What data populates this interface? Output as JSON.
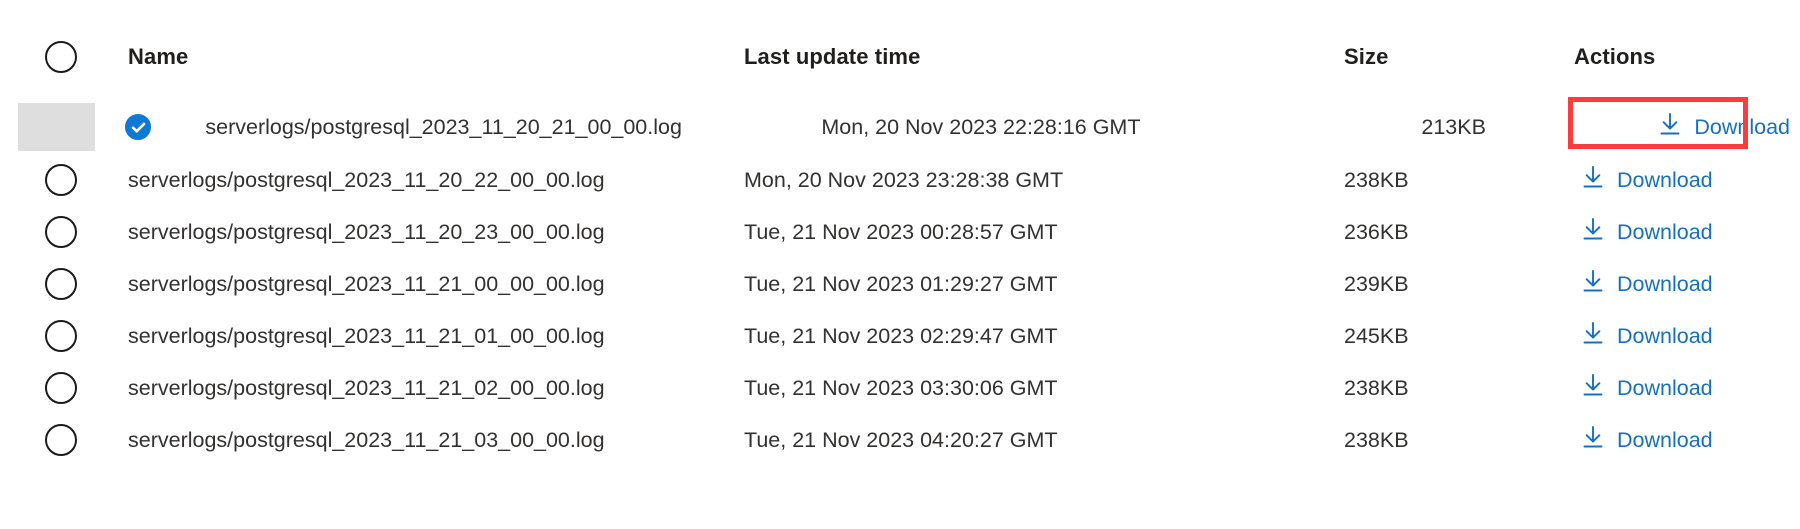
{
  "table": {
    "columns": {
      "select": "",
      "name": "Name",
      "last_update_time": "Last update time",
      "size": "Size",
      "actions": "Actions"
    },
    "select_all_state": "unchecked",
    "rows": [
      {
        "selected": true,
        "name": "serverlogs/postgresql_2023_11_20_21_00_00.log",
        "last_update_time": "Mon, 20 Nov 2023 22:28:16 GMT",
        "size": "213KB",
        "action_label": "Download"
      },
      {
        "selected": false,
        "name": "serverlogs/postgresql_2023_11_20_22_00_00.log",
        "last_update_time": "Mon, 20 Nov 2023 23:28:38 GMT",
        "size": "238KB",
        "action_label": "Download"
      },
      {
        "selected": false,
        "name": "serverlogs/postgresql_2023_11_20_23_00_00.log",
        "last_update_time": "Tue, 21 Nov 2023 00:28:57 GMT",
        "size": "236KB",
        "action_label": "Download"
      },
      {
        "selected": false,
        "name": "serverlogs/postgresql_2023_11_21_00_00_00.log",
        "last_update_time": "Tue, 21 Nov 2023 01:29:27 GMT",
        "size": "239KB",
        "action_label": "Download"
      },
      {
        "selected": false,
        "name": "serverlogs/postgresql_2023_11_21_01_00_00.log",
        "last_update_time": "Tue, 21 Nov 2023 02:29:47 GMT",
        "size": "245KB",
        "action_label": "Download"
      },
      {
        "selected": false,
        "name": "serverlogs/postgresql_2023_11_21_02_00_00.log",
        "last_update_time": "Tue, 21 Nov 2023 03:30:06 GMT",
        "size": "238KB",
        "action_label": "Download"
      },
      {
        "selected": false,
        "name": "serverlogs/postgresql_2023_11_21_03_00_00.log",
        "last_update_time": "Tue, 21 Nov 2023 04:20:27 GMT",
        "size": "238KB",
        "action_label": "Download"
      }
    ]
  },
  "icons": {
    "checked_circle": "check-circle-icon",
    "unchecked_circle": "circle-icon",
    "download": "download-icon"
  },
  "colors": {
    "link": "#1670c1",
    "selected_row_background": "#dedede",
    "checked_circle": "#0f7ad4",
    "annotation_box": "#f93d3d",
    "text": "#323130",
    "header_text": "#201f1e",
    "page_background": "#ffffff"
  },
  "annotation": {
    "target": "download-link-row-1",
    "shape": "rectangle"
  }
}
